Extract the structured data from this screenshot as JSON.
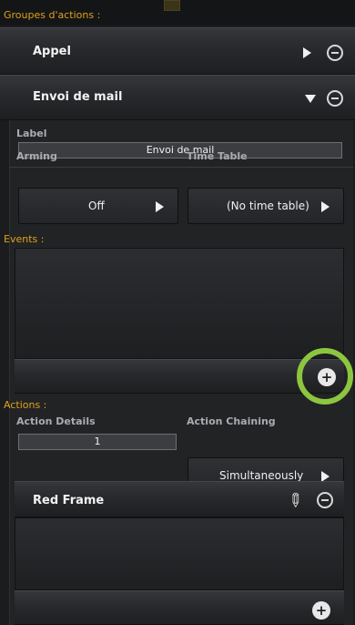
{
  "header": {
    "title": "Groupes d'actions :"
  },
  "groups": [
    {
      "label": "Appel",
      "expanded": false
    },
    {
      "label": "Envoi de mail",
      "expanded": true
    }
  ],
  "detail": {
    "label_caption": "Label",
    "label_value": "Envoi de mail",
    "arming_caption": "Arming",
    "arming_value": "Off",
    "timetable_caption": "Time Table",
    "timetable_value": "(No time table)"
  },
  "events": {
    "title": "Events :"
  },
  "actions": {
    "title": "Actions :",
    "details_caption": "Action Details",
    "details_value": "1",
    "chaining_caption": "Action Chaining",
    "chaining_value": "Simultaneously"
  },
  "frame": {
    "title": "Red Frame"
  },
  "colors": {
    "accent": "#e0a21a",
    "highlight": "#8cc63f"
  }
}
